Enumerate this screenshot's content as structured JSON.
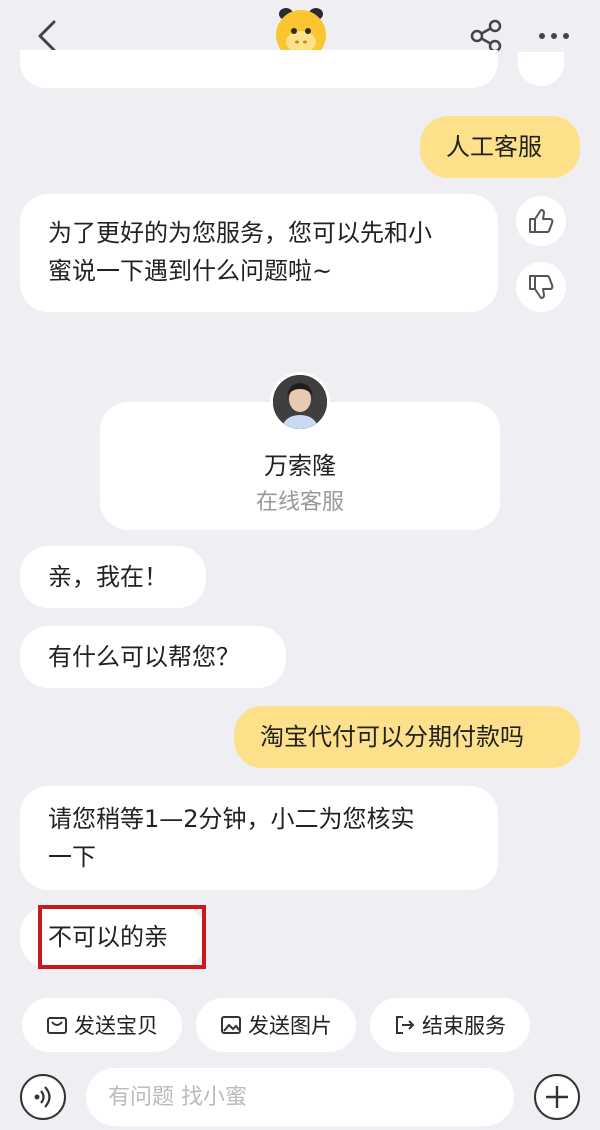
{
  "header": {
    "back_icon": "chevron-left-icon",
    "logo_icon": "mascot-logo-icon",
    "share_icon": "share-icon",
    "more_icon": "more-icon"
  },
  "messages": [
    {
      "from": "user",
      "text": "人工客服"
    },
    {
      "from": "bot",
      "line1": "为了更好的为您服务，您可以先和小",
      "line2": "蜜说一下遇到什么问题啦~"
    },
    {
      "from": "agent",
      "text": "亲，我在！"
    },
    {
      "from": "agent",
      "text": "有什么可以帮您？"
    },
    {
      "from": "user",
      "text": "淘宝代付可以分期付款吗"
    },
    {
      "from": "agent",
      "line1": "请您稍等1—2分钟，小二为您核实",
      "line2": "一下"
    },
    {
      "from": "agent",
      "text": "不可以的亲"
    }
  ],
  "agent_card": {
    "name": "万索隆",
    "role": "在线客服"
  },
  "quick_actions": [
    {
      "label": "发送宝贝",
      "icon": "bag-icon"
    },
    {
      "label": "发送图片",
      "icon": "image-icon"
    },
    {
      "label": "结束服务",
      "icon": "exit-icon"
    }
  ],
  "input": {
    "placeholder": "有问题 找小蜜"
  },
  "colors": {
    "user_bubble": "#fde08a",
    "highlight": "#c8191e",
    "background": "#efeef3"
  }
}
